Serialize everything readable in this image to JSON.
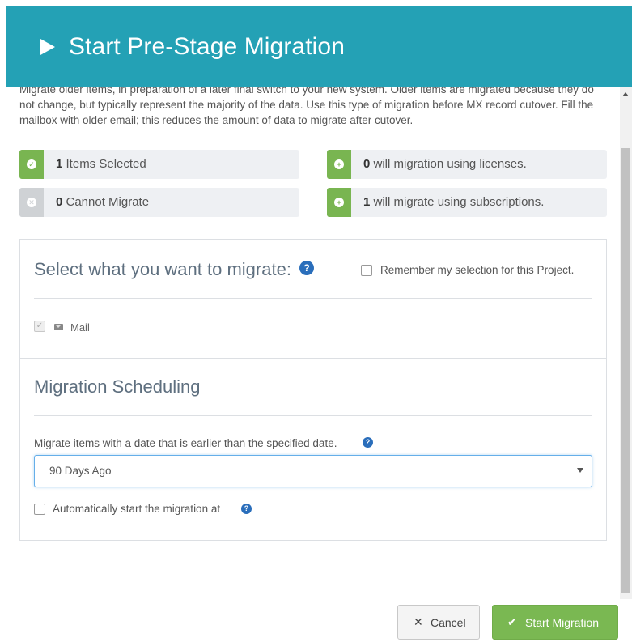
{
  "dialog": {
    "title": "Start Pre-Stage Migration",
    "intro": "Migrate older items, in preparation of a later final switch to your new system. Older items are migrated because they do not change, but typically represent the majority of the data. Use this type of migration before MX record cutover. Fill the mailbox with older email; this reduces the amount of data to migrate after cutover."
  },
  "stats": {
    "selected": {
      "count": "1",
      "text": " Items Selected",
      "icon": "check-circle-icon"
    },
    "cannot": {
      "count": "0",
      "text": " Cannot Migrate",
      "icon": "x-circle-icon"
    },
    "licenses": {
      "count": "0",
      "text": " will migration using licenses.",
      "icon": "plus-circle-icon"
    },
    "subscriptions": {
      "count": "1",
      "text": " will migrate using subscriptions.",
      "icon": "plus-circle-icon"
    }
  },
  "select_section": {
    "title": "Select what you want to migrate:",
    "help": "?",
    "remember_label": "Remember my selection for this Project.",
    "mail_label": "Mail"
  },
  "schedule_section": {
    "title": "Migration Scheduling",
    "date_label": "Migrate items with a date that is earlier than the specified date.",
    "date_value": "90 Days Ago",
    "auto_start_label": "Automatically start the migration at"
  },
  "footer": {
    "cancel_label": "Cancel",
    "start_label": "Start Migration"
  },
  "colors": {
    "header": "#24a1b5",
    "success": "#79b551",
    "muted": "#cfd2d5",
    "help": "#2a6ebb"
  }
}
